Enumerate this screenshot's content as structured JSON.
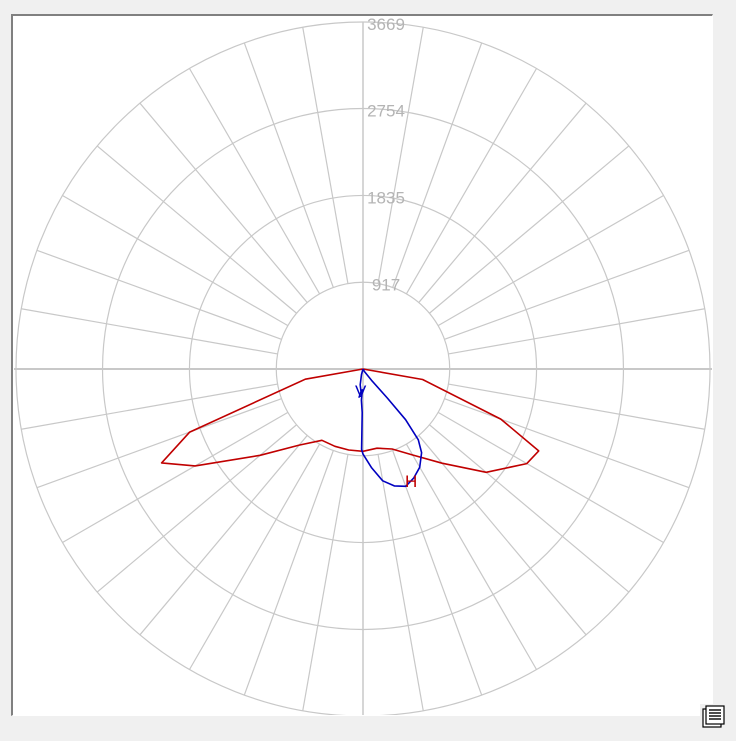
{
  "chart_data": {
    "type": "polar",
    "radial_ticks": [
      917,
      1835,
      2754,
      3669
    ],
    "radial_max": 3669,
    "angle_step_deg": 10,
    "grid": true,
    "series": [
      {
        "name": "H",
        "color": "#c00000",
        "points": [
          [
            -90,
            0
          ],
          [
            -80,
            620
          ],
          [
            -70,
            1950
          ],
          [
            -65,
            2350
          ],
          [
            -60,
            2050
          ],
          [
            -50,
            1420
          ],
          [
            -40,
            1050
          ],
          [
            -30,
            870
          ],
          [
            -20,
            870
          ],
          [
            -10,
            870
          ],
          [
            0,
            870
          ],
          [
            10,
            850
          ],
          [
            20,
            900
          ],
          [
            30,
            1050
          ],
          [
            40,
            1300
          ],
          [
            50,
            1700
          ],
          [
            60,
            2000
          ],
          [
            65,
            2050
          ],
          [
            70,
            1550
          ],
          [
            80,
            640
          ],
          [
            90,
            0
          ]
        ]
      },
      {
        "name": "V",
        "color": "#0000c0",
        "points": [
          [
            -180,
            0
          ],
          [
            -15,
            60
          ],
          [
            -10,
            170
          ],
          [
            -5,
            240
          ],
          [
            -8,
            300
          ],
          [
            -2,
            220
          ],
          [
            -3,
            330
          ],
          [
            -1,
            460
          ],
          [
            -1,
            660
          ],
          [
            -1,
            850
          ],
          [
            0,
            900
          ],
          [
            5,
            1050
          ],
          [
            10,
            1200
          ],
          [
            15,
            1280
          ],
          [
            20,
            1320
          ],
          [
            25,
            1270
          ],
          [
            30,
            1200
          ],
          [
            35,
            1080
          ],
          [
            38,
            950
          ],
          [
            40,
            700
          ],
          [
            40,
            400
          ],
          [
            37,
            150
          ],
          [
            30,
            30
          ],
          [
            0,
            0
          ]
        ]
      }
    ]
  },
  "colors": {
    "grid": "#c8c8c8",
    "tick_label": "#b4b4b4",
    "background": "#ffffff"
  },
  "corner_button": {
    "icon": "document-list-icon"
  }
}
